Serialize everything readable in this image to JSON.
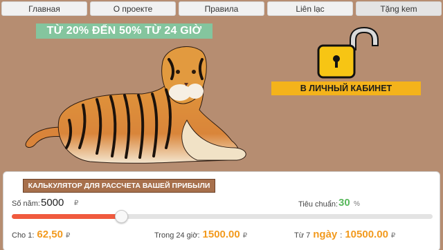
{
  "nav": [
    {
      "label": "Главная"
    },
    {
      "label": "О проекте"
    },
    {
      "label": "Правила"
    },
    {
      "label": "Liên lạc"
    },
    {
      "label": "Tặng kem"
    }
  ],
  "promo": {
    "text": "TỪ 20% ĐẾN 50% TỪ 24 GIỜ"
  },
  "cabinet_button": {
    "label": "В ЛИЧНЫЙ КАБИНЕТ"
  },
  "calculator": {
    "title": "КАЛЬКУЛЯТОР ДЛЯ РАССЧЕТА ВАШЕЙ ПРИБЫЛИ",
    "amount_label": "Số năm:",
    "amount_value": "5000",
    "currency": "₽",
    "rate_label": "Tiêu chuẩn:",
    "rate_value": "30",
    "rate_unit": "%",
    "slider_fraction": 0.26,
    "results": [
      {
        "label": "Cho 1:",
        "value": "62,50",
        "currency": "₽"
      },
      {
        "label": "Trong 24 giờ:",
        "value": "1500.00",
        "currency": "₽"
      },
      {
        "label": "Từ 7",
        "label2": "ngày",
        "separator": ":",
        "value": "10500.00",
        "currency": "₽"
      }
    ]
  },
  "colors": {
    "background": "#b68d71",
    "promo": "#84c59e",
    "cabinet": "#f4b31b",
    "calc_title": "#a7704c",
    "slider_fill": "#f05a3e",
    "rate": "#58b85c",
    "result": "#f29a1e"
  },
  "icons": {
    "lock": "open-padlock-icon",
    "tiger": "tiger-illustration"
  }
}
